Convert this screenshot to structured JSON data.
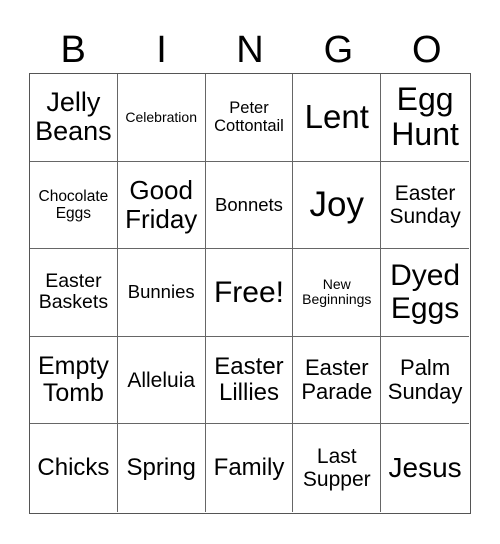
{
  "title_letters": [
    "B",
    "I",
    "N",
    "G",
    "O"
  ],
  "grid": [
    [
      {
        "text": "Jelly Beans",
        "lines": [
          "Jelly",
          "Beans"
        ],
        "size": 27
      },
      {
        "text": "Celebration",
        "lines": [
          "Celebration"
        ],
        "size": 14
      },
      {
        "text": "Peter Cottontail",
        "lines": [
          "Peter",
          "Cottontail"
        ],
        "size": 16.5
      },
      {
        "text": "Lent",
        "lines": [
          "Lent"
        ],
        "size": 33
      },
      {
        "text": "Egg Hunt",
        "lines": [
          "Egg",
          "Hunt"
        ],
        "size": 32
      }
    ],
    [
      {
        "text": "Chocolate Eggs",
        "lines": [
          "Chocolate",
          "Eggs"
        ],
        "size": 15.5
      },
      {
        "text": "Good Friday",
        "lines": [
          "Good",
          "Friday"
        ],
        "size": 26
      },
      {
        "text": "Bonnets",
        "lines": [
          "Bonnets"
        ],
        "size": 18.5
      },
      {
        "text": "Joy",
        "lines": [
          "Joy"
        ],
        "size": 35
      },
      {
        "text": "Easter Sunday",
        "lines": [
          "Easter",
          "Sunday"
        ],
        "size": 21
      }
    ],
    [
      {
        "text": "Easter Baskets",
        "lines": [
          "Easter",
          "Baskets"
        ],
        "size": 19.5
      },
      {
        "text": "Bunnies",
        "lines": [
          "Bunnies"
        ],
        "size": 18.5
      },
      {
        "text": "Free!",
        "lines": [
          "Free!"
        ],
        "size": 30
      },
      {
        "text": "New Beginnings",
        "lines": [
          "New",
          "Beginnings"
        ],
        "size": 14
      },
      {
        "text": "Dyed Eggs",
        "lines": [
          "Dyed",
          "Eggs"
        ],
        "size": 30
      }
    ],
    [
      {
        "text": "Empty Tomb",
        "lines": [
          "Empty",
          "Tomb"
        ],
        "size": 25
      },
      {
        "text": "Alleluia",
        "lines": [
          "Alleluia"
        ],
        "size": 21
      },
      {
        "text": "Easter Lillies",
        "lines": [
          "Easter",
          "Lillies"
        ],
        "size": 24
      },
      {
        "text": "Easter Parade",
        "lines": [
          "Easter",
          "Parade"
        ],
        "size": 22
      },
      {
        "text": "Palm Sunday",
        "lines": [
          "Palm",
          "Sunday"
        ],
        "size": 22
      }
    ],
    [
      {
        "text": "Chicks",
        "lines": [
          "Chicks"
        ],
        "size": 24
      },
      {
        "text": "Spring",
        "lines": [
          "Spring"
        ],
        "size": 24
      },
      {
        "text": "Family",
        "lines": [
          "Family"
        ],
        "size": 24
      },
      {
        "text": "Last Supper",
        "lines": [
          "Last",
          "Supper"
        ],
        "size": 21
      },
      {
        "text": "Jesus",
        "lines": [
          "Jesus"
        ],
        "size": 28
      }
    ]
  ]
}
